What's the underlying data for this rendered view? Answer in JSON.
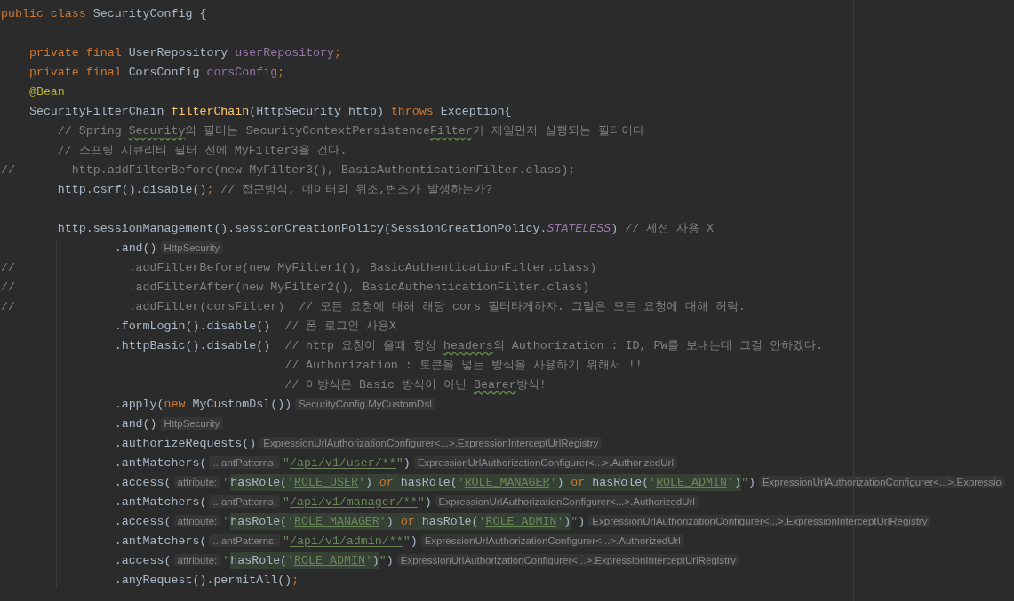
{
  "editor": {
    "lines": [
      {
        "segments": [
          {
            "kind": "code",
            "tokens": [
              {
                "kind": "keyword",
                "text": "public class "
              },
              {
                "kind": "plain",
                "text": "SecurityConfig {"
              }
            ]
          }
        ]
      },
      {
        "kind": "blank"
      },
      {
        "segments": [
          {
            "kind": "code",
            "tokens": [
              {
                "kind": "keyword",
                "text": "    private final "
              },
              {
                "kind": "plain",
                "text": "UserRepository "
              },
              {
                "kind": "field",
                "text": "userRepository"
              },
              {
                "kind": "keyword",
                "text": ";"
              }
            ]
          }
        ]
      },
      {
        "segments": [
          {
            "kind": "code",
            "tokens": [
              {
                "kind": "keyword",
                "text": "    private final "
              },
              {
                "kind": "plain",
                "text": "CorsConfig "
              },
              {
                "kind": "field",
                "text": "corsConfig"
              },
              {
                "kind": "keyword",
                "text": ";"
              }
            ]
          }
        ]
      },
      {
        "segments": [
          {
            "kind": "code",
            "tokens": [
              {
                "kind": "annotation",
                "text": "    @Bean"
              }
            ]
          }
        ]
      },
      {
        "segments": [
          {
            "kind": "code",
            "tokens": [
              {
                "kind": "plain",
                "text": "    SecurityFilterChain "
              },
              {
                "kind": "method",
                "text": "filterChain"
              },
              {
                "kind": "plain",
                "text": "(HttpSecurity http) "
              },
              {
                "kind": "keyword",
                "text": "throws "
              },
              {
                "kind": "plain",
                "text": "Exception{"
              }
            ]
          }
        ]
      },
      {
        "segments": [
          {
            "kind": "code",
            "tokens": [
              {
                "kind": "comment",
                "text": "        // Spring "
              },
              {
                "kind": "typo",
                "text": "Security"
              },
              {
                "kind": "comment",
                "text": "의 필터는 SecurityContextPersistence"
              },
              {
                "kind": "typo",
                "text": "Filter"
              },
              {
                "kind": "comment",
                "text": "가 제일먼저 실행되는 필터이다"
              }
            ]
          }
        ]
      },
      {
        "segments": [
          {
            "kind": "code",
            "tokens": [
              {
                "kind": "comment",
                "text": "        // 스프링 시큐리티 필터 전에 MyFilter3을 건다."
              }
            ]
          }
        ]
      },
      {
        "segments": [
          {
            "kind": "code",
            "tokens": [
              {
                "kind": "comment",
                "text": "//        http.addFilterBefore(new MyFilter3(), BasicAuthenticationFilter.class);"
              }
            ]
          }
        ]
      },
      {
        "segments": [
          {
            "kind": "code",
            "tokens": [
              {
                "kind": "plain",
                "text": "        http.csrf().disable()"
              },
              {
                "kind": "keyword",
                "text": ";"
              },
              {
                "kind": "comment",
                "text": " // 접근방식, 데이터의 위조,변조가 발생하는가?"
              }
            ]
          }
        ]
      },
      {
        "kind": "blank"
      },
      {
        "segments": [
          {
            "kind": "code",
            "tokens": [
              {
                "kind": "plain",
                "text": "        http.sessionManagement().sessionCreationPolicy(SessionCreationPolicy."
              },
              {
                "kind": "static",
                "text": "STATELESS"
              },
              {
                "kind": "plain",
                "text": ") "
              },
              {
                "kind": "comment",
                "text": "// 세션 사용 X"
              }
            ]
          }
        ]
      },
      {
        "segments": [
          {
            "kind": "code",
            "tokens": [
              {
                "kind": "plain",
                "text": "                .and()"
              }
            ]
          },
          {
            "kind": "hint",
            "text": "HttpSecurity"
          }
        ]
      },
      {
        "segments": [
          {
            "kind": "code",
            "tokens": [
              {
                "kind": "comment",
                "text": "//                .addFilterBefore(new MyFilter1(), BasicAuthenticationFilter.class)"
              }
            ]
          }
        ]
      },
      {
        "segments": [
          {
            "kind": "code",
            "tokens": [
              {
                "kind": "comment",
                "text": "//                .addFilterAfter(new MyFilter2(), BasicAuthenticationFilter.class)"
              }
            ]
          }
        ]
      },
      {
        "segments": [
          {
            "kind": "code",
            "tokens": [
              {
                "kind": "comment",
                "text": "//                .addFilter(corsFilter)  // 모든 요청에 대해 해당 cors 필터타게하자. 그말은 모든 요청에 대해 허락."
              }
            ]
          }
        ]
      },
      {
        "segments": [
          {
            "kind": "code",
            "tokens": [
              {
                "kind": "plain",
                "text": "                .formLogin().disable()"
              },
              {
                "kind": "comment",
                "text": "  // 폼 로그인 사용X"
              }
            ]
          }
        ]
      },
      {
        "segments": [
          {
            "kind": "code",
            "tokens": [
              {
                "kind": "plain",
                "text": "                .httpBasic().disable()"
              },
              {
                "kind": "comment",
                "text": "  // http 요청이 올때 항상 "
              },
              {
                "kind": "typo",
                "text": "headers"
              },
              {
                "kind": "comment",
                "text": "의 Authorization : ID, PW를 보내는데 그걸 안하겠다."
              }
            ]
          }
        ]
      },
      {
        "segments": [
          {
            "kind": "code",
            "tokens": [
              {
                "kind": "comment",
                "text": "                                        // Authorization : 토큰을 넣는 방식을 사용하기 위해서 !!"
              }
            ]
          }
        ]
      },
      {
        "segments": [
          {
            "kind": "code",
            "tokens": [
              {
                "kind": "comment",
                "text": "                                        // 이방식은 Basic 방식이 아닌 "
              },
              {
                "kind": "typo",
                "text": "Bearer"
              },
              {
                "kind": "comment",
                "text": "방식!"
              }
            ]
          }
        ]
      },
      {
        "segments": [
          {
            "kind": "code",
            "tokens": [
              {
                "kind": "plain",
                "text": "                .apply("
              },
              {
                "kind": "keyword",
                "text": "new "
              },
              {
                "kind": "plain",
                "text": "MyCustomDsl())"
              }
            ]
          },
          {
            "kind": "hint",
            "text": "SecurityConfig.MyCustomDsl"
          }
        ]
      },
      {
        "segments": [
          {
            "kind": "code",
            "tokens": [
              {
                "kind": "plain",
                "text": "                .and()"
              }
            ]
          },
          {
            "kind": "hint",
            "text": "HttpSecurity"
          }
        ]
      },
      {
        "segments": [
          {
            "kind": "code",
            "tokens": [
              {
                "kind": "plain",
                "text": "                .authorizeRequests()"
              }
            ]
          },
          {
            "kind": "hint",
            "text": "ExpressionUrlAuthorizationConfigurer<...>.ExpressionInterceptUrlRegistry"
          }
        ]
      },
      {
        "segments": [
          {
            "kind": "code",
            "tokens": [
              {
                "kind": "plain",
                "text": "                .antMatchers("
              }
            ]
          },
          {
            "kind": "param",
            "text": "...antPatterns:"
          },
          {
            "kind": "code",
            "tokens": [
              {
                "kind": "string",
                "text": "\""
              },
              {
                "kind": "ref",
                "text": "/api/v1/user/**"
              },
              {
                "kind": "string",
                "text": "\""
              },
              {
                "kind": "plain",
                "text": ")"
              }
            ]
          },
          {
            "kind": "hint",
            "text": "ExpressionUrlAuthorizationConfigurer<...>.AuthorizedUrl"
          }
        ]
      },
      {
        "segments": [
          {
            "kind": "code",
            "tokens": [
              {
                "kind": "plain",
                "text": "                .access("
              }
            ]
          },
          {
            "kind": "param",
            "text": "attribute:"
          },
          {
            "kind": "code",
            "tokens": [
              {
                "kind": "string",
                "text": "\""
              },
              {
                "kind": "inj",
                "text": "hasRole("
              },
              {
                "kind": "inj-str",
                "text": "'"
              },
              {
                "kind": "inj-ref",
                "text": "ROLE_USER"
              },
              {
                "kind": "inj-str",
                "text": "'"
              },
              {
                "kind": "inj",
                "text": ") "
              },
              {
                "kind": "inj-kw",
                "text": "or"
              },
              {
                "kind": "inj",
                "text": " hasRole("
              },
              {
                "kind": "inj-str",
                "text": "'"
              },
              {
                "kind": "inj-ref",
                "text": "ROLE_MANAGER"
              },
              {
                "kind": "inj-str",
                "text": "'"
              },
              {
                "kind": "inj",
                "text": ") "
              },
              {
                "kind": "inj-kw",
                "text": "or"
              },
              {
                "kind": "inj",
                "text": " hasRole("
              },
              {
                "kind": "inj-str",
                "text": "'"
              },
              {
                "kind": "inj-ref",
                "text": "ROLE_ADMIN"
              },
              {
                "kind": "inj-str",
                "text": "'"
              },
              {
                "kind": "inj",
                "text": ")"
              },
              {
                "kind": "string",
                "text": "\""
              },
              {
                "kind": "plain",
                "text": ")"
              }
            ]
          },
          {
            "kind": "hint",
            "text": "ExpressionUrlAuthorizationConfigurer<...>.Expressio"
          }
        ]
      },
      {
        "segments": [
          {
            "kind": "code",
            "tokens": [
              {
                "kind": "plain",
                "text": "                .antMatchers("
              }
            ]
          },
          {
            "kind": "param",
            "text": "...antPatterns:"
          },
          {
            "kind": "code",
            "tokens": [
              {
                "kind": "string",
                "text": "\""
              },
              {
                "kind": "ref",
                "text": "/api/v1/manager/**"
              },
              {
                "kind": "string",
                "text": "\""
              },
              {
                "kind": "plain",
                "text": ")"
              }
            ]
          },
          {
            "kind": "hint",
            "text": "ExpressionUrlAuthorizationConfigurer<...>.AuthorizedUrl"
          }
        ]
      },
      {
        "segments": [
          {
            "kind": "code",
            "tokens": [
              {
                "kind": "plain",
                "text": "                .access("
              }
            ]
          },
          {
            "kind": "param",
            "text": "attribute:"
          },
          {
            "kind": "code",
            "tokens": [
              {
                "kind": "string",
                "text": "\""
              },
              {
                "kind": "inj",
                "text": "hasRole("
              },
              {
                "kind": "inj-str",
                "text": "'"
              },
              {
                "kind": "inj-ref",
                "text": "ROLE_MANAGER"
              },
              {
                "kind": "inj-str",
                "text": "'"
              },
              {
                "kind": "inj",
                "text": ") "
              },
              {
                "kind": "inj-kw",
                "text": "or"
              },
              {
                "kind": "inj",
                "text": " hasRole("
              },
              {
                "kind": "inj-str",
                "text": "'"
              },
              {
                "kind": "inj-ref",
                "text": "ROLE_ADMIN"
              },
              {
                "kind": "inj-str",
                "text": "'"
              },
              {
                "kind": "inj",
                "text": ")"
              },
              {
                "kind": "string",
                "text": "\""
              },
              {
                "kind": "plain",
                "text": ")"
              }
            ]
          },
          {
            "kind": "hint",
            "text": "ExpressionUrlAuthorizationConfigurer<...>.ExpressionInterceptUrlRegistry"
          }
        ]
      },
      {
        "segments": [
          {
            "kind": "code",
            "tokens": [
              {
                "kind": "plain",
                "text": "                .antMatchers("
              }
            ]
          },
          {
            "kind": "param",
            "text": "...antPatterns:"
          },
          {
            "kind": "code",
            "tokens": [
              {
                "kind": "string",
                "text": "\""
              },
              {
                "kind": "ref",
                "text": "/api/v1/admin/**"
              },
              {
                "kind": "string",
                "text": "\""
              },
              {
                "kind": "plain",
                "text": ")"
              }
            ]
          },
          {
            "kind": "hint",
            "text": "ExpressionUrlAuthorizationConfigurer<...>.AuthorizedUrl"
          }
        ]
      },
      {
        "segments": [
          {
            "kind": "code",
            "tokens": [
              {
                "kind": "plain",
                "text": "                .access("
              }
            ]
          },
          {
            "kind": "param",
            "text": "attribute:"
          },
          {
            "kind": "code",
            "tokens": [
              {
                "kind": "string",
                "text": "\""
              },
              {
                "kind": "inj",
                "text": "hasRole("
              },
              {
                "kind": "inj-str",
                "text": "'"
              },
              {
                "kind": "inj-ref",
                "text": "ROLE_ADMIN"
              },
              {
                "kind": "inj-str",
                "text": "'"
              },
              {
                "kind": "inj",
                "text": ")"
              },
              {
                "kind": "string",
                "text": "\""
              },
              {
                "kind": "plain",
                "text": ")"
              }
            ]
          },
          {
            "kind": "hint",
            "text": "ExpressionUrlAuthorizationConfigurer<...>.ExpressionInterceptUrlRegistry"
          }
        ]
      },
      {
        "segments": [
          {
            "kind": "code",
            "tokens": [
              {
                "kind": "plain",
                "text": "                .anyRequest().permitAll()"
              },
              {
                "kind": "keyword",
                "text": ";"
              }
            ]
          }
        ]
      }
    ]
  }
}
